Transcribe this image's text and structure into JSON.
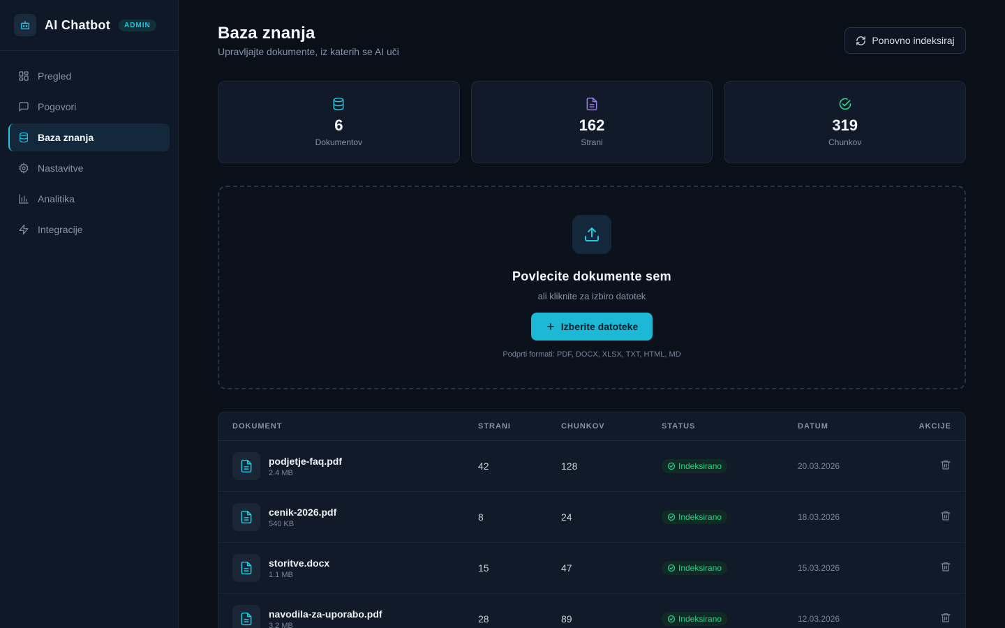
{
  "brand": {
    "name": "AI Chatbot",
    "badge": "ADMIN"
  },
  "sidebar": {
    "items": [
      {
        "label": "Pregled",
        "icon": "grid-icon",
        "active": false
      },
      {
        "label": "Pogovori",
        "icon": "chat-icon",
        "active": false
      },
      {
        "label": "Baza znanja",
        "icon": "database-icon",
        "active": true
      },
      {
        "label": "Nastavitve",
        "icon": "gear-icon",
        "active": false
      },
      {
        "label": "Analitika",
        "icon": "bar-chart-icon",
        "active": false
      },
      {
        "label": "Integracije",
        "icon": "lightning-icon",
        "active": false
      }
    ]
  },
  "header": {
    "title": "Baza znanja",
    "subtitle": "Upravljajte dokumente, iz katerih se AI uči",
    "reindex_label": "Ponovno indeksiraj"
  },
  "stats": [
    {
      "value": "6",
      "label": "Dokumentov",
      "icon": "database-icon",
      "color": "#22c7e0"
    },
    {
      "value": "162",
      "label": "Strani",
      "icon": "file-icon",
      "color": "#9b7cf0"
    },
    {
      "value": "319",
      "label": "Chunkov",
      "icon": "check-circle-icon",
      "color": "#2bd38a"
    }
  ],
  "dropzone": {
    "title": "Povlecite dokumente sem",
    "subtitle": "ali kliknite za izbiro datotek",
    "button_label": "Izberite datoteke",
    "formats": "Podprti formati: PDF, DOCX, XLSX, TXT, HTML, MD"
  },
  "table": {
    "headers": {
      "document": "DOKUMENT",
      "pages": "STRANI",
      "chunks": "CHUNKOV",
      "status": "STATUS",
      "date": "DATUM",
      "actions": "AKCIJE"
    },
    "rows": [
      {
        "name": "podjetje-faq.pdf",
        "size": "2.4 MB",
        "pages": "42",
        "chunks": "128",
        "status": "Indeksirano",
        "date": "20.03.2026"
      },
      {
        "name": "cenik-2026.pdf",
        "size": "540 KB",
        "pages": "8",
        "chunks": "24",
        "status": "Indeksirano",
        "date": "18.03.2026"
      },
      {
        "name": "storitve.docx",
        "size": "1.1 MB",
        "pages": "15",
        "chunks": "47",
        "status": "Indeksirano",
        "date": "15.03.2026"
      },
      {
        "name": "navodila-za-uporabo.pdf",
        "size": "3.2 MB",
        "pages": "28",
        "chunks": "89",
        "status": "Indeksirano",
        "date": "12.03.2026"
      }
    ]
  },
  "colors": {
    "accent": "#22c7e0",
    "success": "#2bd38a",
    "background": "#0a1018",
    "sidebar": "#0f1826"
  }
}
